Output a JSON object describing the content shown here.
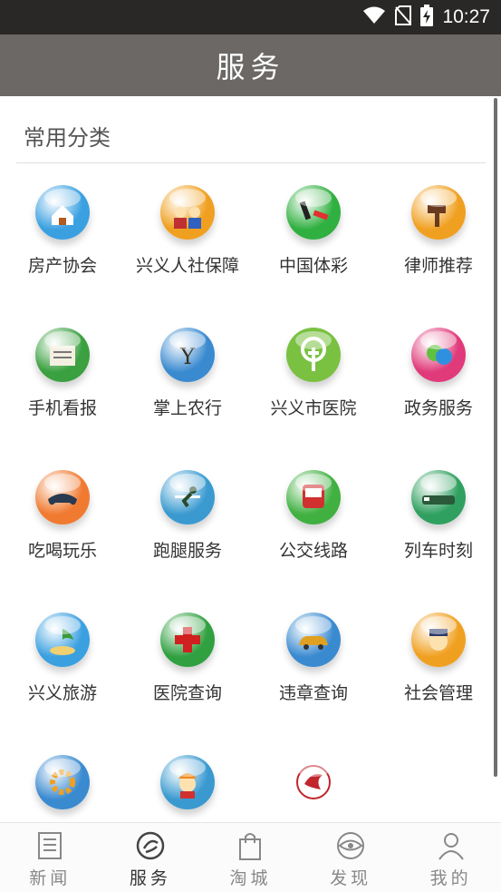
{
  "status": {
    "time": "10:27"
  },
  "header": {
    "title": "服务"
  },
  "section": {
    "title": "常用分类"
  },
  "services": [
    {
      "label": "房产协会",
      "icon": "house-icon",
      "color": "#3aa0e0"
    },
    {
      "label": "兴义人社保障",
      "icon": "people-icon",
      "color": "#f0a020"
    },
    {
      "label": "中国体彩",
      "icon": "lottery-icon",
      "color": "#30b040"
    },
    {
      "label": "律师推荐",
      "icon": "gavel-icon",
      "color": "#f0a020"
    },
    {
      "label": "手机看报",
      "icon": "newspaper-icon",
      "color": "#3aa040"
    },
    {
      "label": "掌上农行",
      "icon": "abc-bank-icon",
      "color": "#3a8ad0"
    },
    {
      "label": "兴义市医院",
      "icon": "hospital-tree-icon",
      "color": "#7ac142"
    },
    {
      "label": "政务服务",
      "icon": "government-icon",
      "color": "#e03a7a"
    },
    {
      "label": "吃喝玩乐",
      "icon": "gamepad-icon",
      "color": "#f07a30"
    },
    {
      "label": "跑腿服务",
      "icon": "runner-icon",
      "color": "#3a9ad0"
    },
    {
      "label": "公交线路",
      "icon": "bus-icon",
      "color": "#40b040"
    },
    {
      "label": "列车时刻",
      "icon": "train-icon",
      "color": "#30a060"
    },
    {
      "label": "兴义旅游",
      "icon": "beach-icon",
      "color": "#3aa0e0"
    },
    {
      "label": "医院查询",
      "icon": "red-cross-icon",
      "color": "#30a040"
    },
    {
      "label": "违章查询",
      "icon": "car-icon",
      "color": "#3a8ad0"
    },
    {
      "label": "社会管理",
      "icon": "police-icon",
      "color": "#f0a020"
    },
    {
      "label": "",
      "icon": "gear-icon",
      "color": "#3a8ad0"
    },
    {
      "label": "",
      "icon": "worker-icon",
      "color": "#3a9ad0"
    },
    {
      "label": "",
      "icon": "school-seal-icon",
      "color": "#c0262c"
    }
  ],
  "tabs": [
    {
      "label": "新闻",
      "icon": "newspaper-tab-icon",
      "active": false
    },
    {
      "label": "服务",
      "icon": "service-tab-icon",
      "active": true
    },
    {
      "label": "淘城",
      "icon": "shopping-bag-icon",
      "active": false
    },
    {
      "label": "发现",
      "icon": "eye-icon",
      "active": false
    },
    {
      "label": "我的",
      "icon": "person-icon",
      "active": false
    }
  ]
}
